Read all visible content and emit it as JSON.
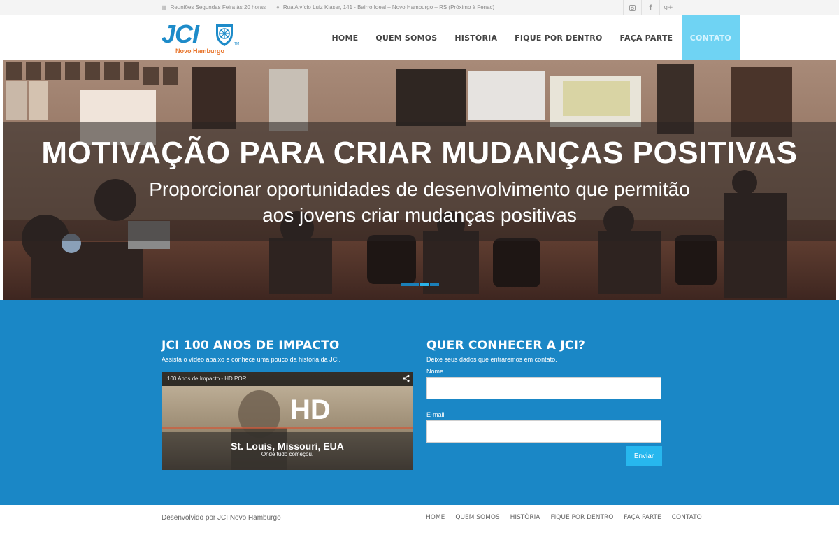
{
  "topbar": {
    "meetings": "Reuniões Segundas Feira às 20 horas",
    "address": "Rua Alvício Luiz Klaser, 141 - Bairro Ideal – Novo Hamburgo – RS (Próximo à Fenac)",
    "meetings_icon": "calendar-icon",
    "address_icon": "map-pin-icon",
    "social": [
      {
        "name": "instagram-icon",
        "glyph": "◙"
      },
      {
        "name": "facebook-icon",
        "glyph": "f"
      },
      {
        "name": "google-plus-icon",
        "glyph": "g+"
      }
    ]
  },
  "logo": {
    "text": "JCI",
    "subtitle": "Novo Hamburgo",
    "tm": "TM"
  },
  "nav": {
    "items": [
      "HOME",
      "QUEM SOMOS",
      "HISTÓRIA",
      "FIQUE POR DENTRO",
      "FAÇA PARTE",
      "CONTATO"
    ],
    "active_index": 5
  },
  "hero": {
    "title": "MOTIVAÇÃO PARA CRIAR MUDANÇAS POSITIVAS",
    "lead_line1": "Proporcionar oportunidades de desenvolvimento que permitão",
    "lead_line2": "aos jovens criar mudanças positivas",
    "slides": 4,
    "active_slide": 2
  },
  "video_section": {
    "title": "JCI 100 ANOS DE IMPACTO",
    "description": "Assista o vídeo abaixo e conhece uma pouco da história da JCI.",
    "video_title": "100 Anos de Impacto - HD POR",
    "hd_label": "HD",
    "caption": "St. Louis, Missouri, EUA",
    "subcaption": "Onde tudo começou."
  },
  "form_section": {
    "title": "QUER CONHECER A JCI?",
    "description": "Deixe seus dados que entraremos em contato.",
    "name_label": "Nome",
    "name_value": "",
    "email_label": "E-mail",
    "email_value": "",
    "submit": "Enviar"
  },
  "footer": {
    "credit": "Desenvolvido por JCI Novo Hamburgo",
    "nav": [
      "HOME",
      "QUEM SOMOS",
      "HISTÓRIA",
      "FIQUE POR DENTRO",
      "FAÇA PARTE",
      "CONTATO"
    ]
  },
  "colors": {
    "brand_blue": "#1a87c6",
    "brand_orange": "#e8742a",
    "active_nav": "#6fd3f3",
    "button": "#27b7ee"
  }
}
